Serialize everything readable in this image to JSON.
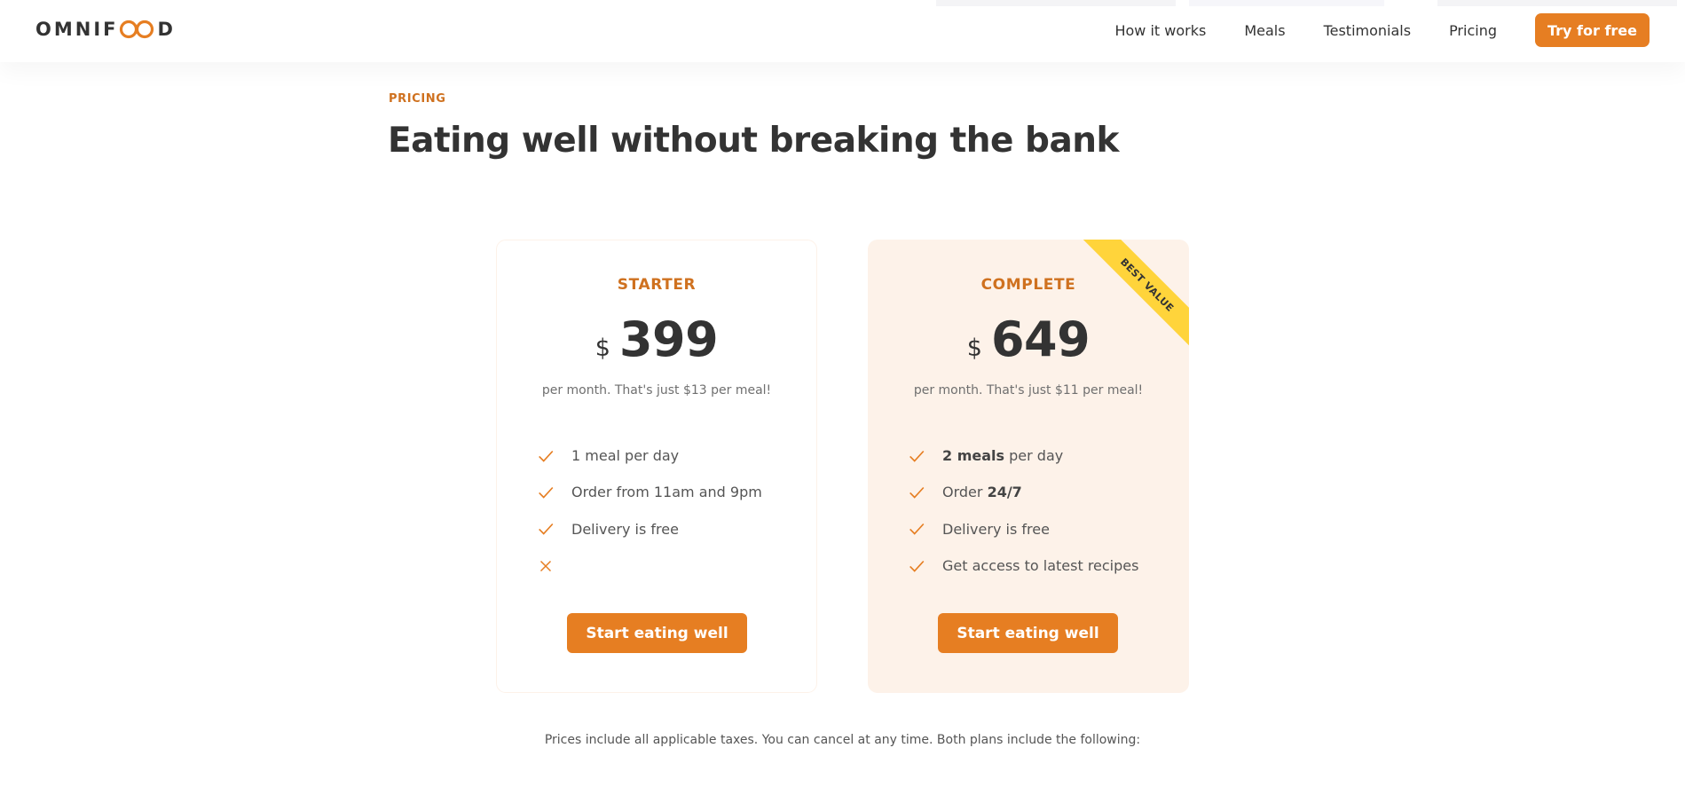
{
  "logo": {
    "text_before": "OMNIF",
    "text_after": "D"
  },
  "nav": {
    "items": [
      "How it works",
      "Meals",
      "Testimonials",
      "Pricing"
    ],
    "cta": "Try for free"
  },
  "section": {
    "subheading": "Pricing",
    "heading": "Eating well without breaking the bank"
  },
  "plans": [
    {
      "name": "STARTER",
      "currency": "$",
      "price": "399",
      "note": "per month. That's just $13 per meal!",
      "features": [
        {
          "before": "",
          "bold": "",
          "after": "1 meal per day",
          "icon": "checkmark-icon"
        },
        {
          "before": "",
          "bold": "",
          "after": "Order from 11am and 9pm",
          "icon": "checkmark-icon"
        },
        {
          "before": "",
          "bold": "",
          "after": "Delivery is free",
          "icon": "checkmark-icon"
        },
        {
          "before": "",
          "bold": "",
          "after": "",
          "icon": "close-icon"
        }
      ],
      "button": "Start eating well"
    },
    {
      "name": "COMPLETE",
      "currency": "$",
      "price": "649",
      "note": "per month. That's just $11 per meal!",
      "ribbon": "BEST VALUE",
      "features": [
        {
          "before": "",
          "bold": "2 meals",
          "after": " per day",
          "icon": "checkmark-icon"
        },
        {
          "before": "Order ",
          "bold": "24/7",
          "after": "",
          "icon": "checkmark-icon"
        },
        {
          "before": "",
          "bold": "",
          "after": "Delivery is free",
          "icon": "checkmark-icon"
        },
        {
          "before": "",
          "bold": "",
          "after": "Get access to latest recipes",
          "icon": "checkmark-icon"
        }
      ],
      "button": "Start eating well"
    }
  ],
  "footnote": "Prices include all applicable taxes. You can cancel at any time. Both plans include the following:",
  "colors": {
    "accent": "#e67e22",
    "accent_dark": "#cf711f",
    "tint": "#fdf2e9",
    "ribbon": "#ffd43b"
  }
}
